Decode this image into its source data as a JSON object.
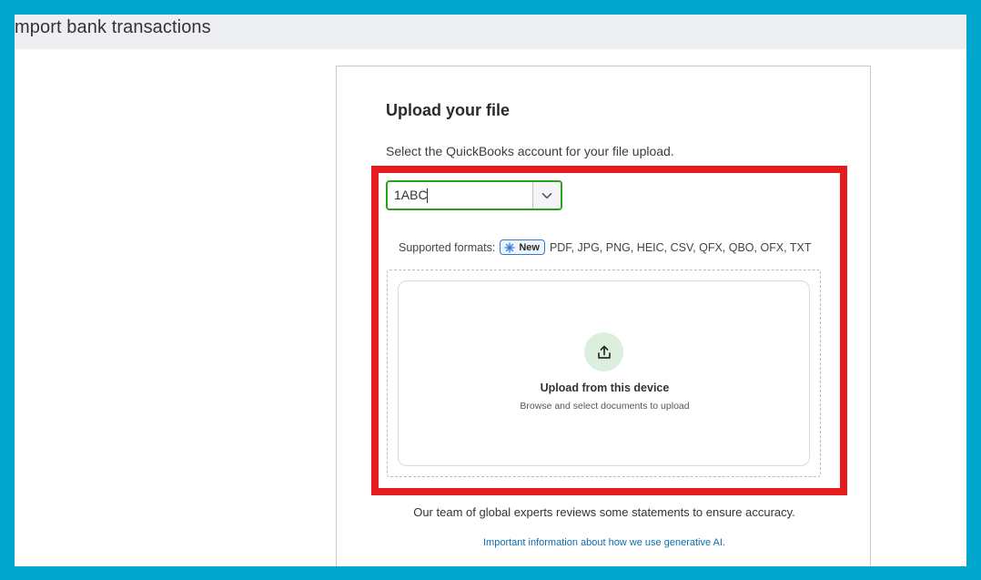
{
  "page": {
    "title": "mport bank transactions"
  },
  "card": {
    "title": "Upload your file",
    "subtitle": "Select the QuickBooks account for your file upload.",
    "account_select": {
      "value": "1ABC",
      "toggle_icon": "chevron-down-icon"
    },
    "formats": {
      "label": "Supported formats:",
      "badge_label": "New",
      "badge_icon": "sparkle-icon",
      "list": "PDF, JPG, PNG, HEIC, CSV, QFX, QBO, OFX, TXT"
    },
    "dropzone": {
      "icon": "upload-icon",
      "title": "Upload from this device",
      "subtitle": "Browse and select documents to upload"
    },
    "review_note": "Our team of global experts reviews some statements to ensure accuracy.",
    "ai_link": "Important information about how we use generative AI."
  },
  "colors": {
    "frame": "#01a6cf",
    "highlight": "#e41b1f",
    "select_border": "#2ca01c",
    "link": "#0b6db3",
    "badge_border": "#2f7cd6",
    "upload_circle": "#dcefdc"
  }
}
